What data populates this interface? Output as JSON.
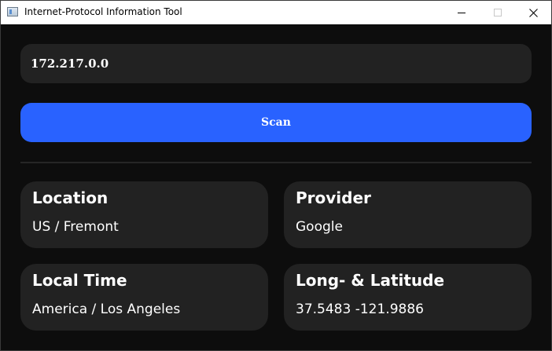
{
  "window": {
    "title": "Internet-Protocol Information Tool"
  },
  "ip_input": {
    "value": "172.217.0.0"
  },
  "scan_button": {
    "label": "Scan"
  },
  "cards": [
    {
      "title": "Location",
      "value": "US / Fremont"
    },
    {
      "title": "Provider",
      "value": "Google"
    },
    {
      "title": "Local Time",
      "value": "America / Los Angeles"
    },
    {
      "title": "Long- & Latitude",
      "value": "37.5483 -121.9886"
    }
  ],
  "colors": {
    "background": "#0d0d0d",
    "surface": "#222222",
    "accent": "#2962ff",
    "text": "#ffffff"
  },
  "icons": {
    "app": "app-window-icon",
    "minimize": "minimize-icon",
    "maximize": "maximize-icon",
    "close": "close-icon"
  }
}
